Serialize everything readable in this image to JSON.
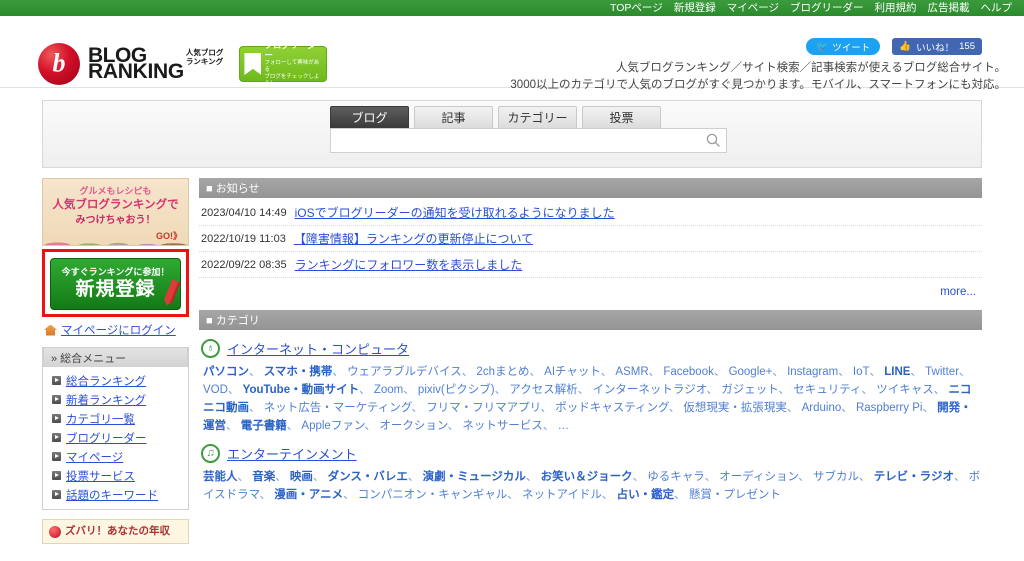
{
  "topnav": {
    "items": [
      {
        "label": "TOPページ"
      },
      {
        "label": "新規登録"
      },
      {
        "label": "マイページ"
      },
      {
        "label": "ブログリーダー"
      },
      {
        "label": "利用規約"
      },
      {
        "label": "広告掲載"
      },
      {
        "label": "ヘルプ"
      }
    ]
  },
  "header": {
    "logo_main_line1": "BLOG",
    "logo_main_line2": "RANKING",
    "logo_sub_line1": "人気ブログ",
    "logo_sub_line2": "ランキング",
    "reader_badge_title": "ブログリーダー",
    "reader_badge_line1": "フォローして興味がある",
    "reader_badge_line2": "ブログをチェックしよう！",
    "tweet_label": "ツイート",
    "like_label": "いいね！",
    "like_count": "155",
    "tagline_line1": "人気ブログランキング／サイト検索／記事検索が使えるブログ総合サイト。",
    "tagline_line2": "3000以上のカテゴリで人気のブログがすぐ見つかります。モバイル、スマートフォンにも対応。"
  },
  "search": {
    "tabs": [
      {
        "label": "ブログ",
        "active": true
      },
      {
        "label": "記事",
        "active": false
      },
      {
        "label": "カテゴリー",
        "active": false
      },
      {
        "label": "投票",
        "active": false
      }
    ],
    "input_value": "",
    "placeholder": "",
    "icon": "search-icon"
  },
  "sidebar": {
    "banner": {
      "line1": "グルメもレシピも",
      "line2": "人気ブログランキングで",
      "line3": "みつけちゃおう！",
      "cta": "GO!》"
    },
    "register": {
      "sub_label": "今すぐランキングに参加！",
      "main_label": "新規登録",
      "highlight_color": "#ee1111"
    },
    "login_label": "マイページにログイン",
    "menu_title": "» 総合メニュー",
    "menu_items": [
      {
        "label": "総合ランキング"
      },
      {
        "label": "新着ランキング"
      },
      {
        "label": "カテゴリ一覧"
      },
      {
        "label": "ブログリーダー"
      },
      {
        "label": "マイページ"
      },
      {
        "label": "投票サービス"
      },
      {
        "label": "話題のキーワード"
      }
    ],
    "promo": {
      "line1": "ズバリ！あなたの年収"
    }
  },
  "news": {
    "section_title": "■ お知らせ",
    "items": [
      {
        "date": "2023/04/10 14:49",
        "title": "iOSでブログリーダーの通知を受け取れるようになりました"
      },
      {
        "date": "2022/10/19 11:03",
        "title": "【障害情報】ランキングの更新停止について"
      },
      {
        "date": "2022/09/22 08:35",
        "title": "ランキングにフォロワー数を表示しました"
      }
    ],
    "more_label": "more..."
  },
  "categories": {
    "section_title": "■ カテゴリ",
    "blocks": [
      {
        "icon": "globe-icon",
        "icon_glyph": "♁",
        "title": "インターネット・コンピュータ",
        "links": [
          {
            "label": "パソコン",
            "bold": true
          },
          {
            "label": "スマホ・携帯",
            "bold": true
          },
          {
            "label": "ウェアラブルデバイス",
            "bold": false
          },
          {
            "label": "2chまとめ",
            "bold": false
          },
          {
            "label": "AIチャット",
            "bold": false
          },
          {
            "label": "ASMR",
            "bold": false
          },
          {
            "label": "Facebook",
            "bold": false
          },
          {
            "label": "Google+",
            "bold": false
          },
          {
            "label": "Instagram",
            "bold": false
          },
          {
            "label": "IoT",
            "bold": false
          },
          {
            "label": "LINE",
            "bold": true
          },
          {
            "label": "Twitter",
            "bold": false
          },
          {
            "label": "VOD",
            "bold": false
          },
          {
            "label": "YouTube・動画サイト",
            "bold": true
          },
          {
            "label": "Zoom",
            "bold": false
          },
          {
            "label": "pixiv(ピクシブ)",
            "bold": false
          },
          {
            "label": "アクセス解析",
            "bold": false
          },
          {
            "label": "インターネットラジオ",
            "bold": false
          },
          {
            "label": "ガジェット",
            "bold": false
          },
          {
            "label": "セキュリティ",
            "bold": false
          },
          {
            "label": "ツイキャス",
            "bold": false
          },
          {
            "label": "ニコニコ動画",
            "bold": true
          },
          {
            "label": "ネット広告・マーケティング",
            "bold": false
          },
          {
            "label": "フリマ・フリマアプリ",
            "bold": false
          },
          {
            "label": "ポッドキャスティング",
            "bold": false
          },
          {
            "label": "仮想現実・拡張現実",
            "bold": false
          },
          {
            "label": "Arduino",
            "bold": false
          },
          {
            "label": "Raspberry Pi",
            "bold": false
          },
          {
            "label": "開発・運営",
            "bold": true
          },
          {
            "label": "電子書籍",
            "bold": true
          },
          {
            "label": "Appleファン",
            "bold": false
          },
          {
            "label": "オークション",
            "bold": false
          },
          {
            "label": "ネットサービス",
            "bold": false
          },
          {
            "label": "…",
            "bold": false
          }
        ]
      },
      {
        "icon": "music-note-icon",
        "icon_glyph": "♫",
        "title": "エンターテインメント",
        "links": [
          {
            "label": "芸能人",
            "bold": true
          },
          {
            "label": "音楽",
            "bold": true
          },
          {
            "label": "映画",
            "bold": true
          },
          {
            "label": "ダンス・バレエ",
            "bold": true
          },
          {
            "label": "演劇・ミュージカル",
            "bold": true
          },
          {
            "label": "お笑い＆ジョーク",
            "bold": true
          },
          {
            "label": "ゆるキャラ",
            "bold": false
          },
          {
            "label": "オーディション",
            "bold": false
          },
          {
            "label": "サブカル",
            "bold": false
          },
          {
            "label": "テレビ・ラジオ",
            "bold": true
          },
          {
            "label": "ボイスドラマ",
            "bold": false
          },
          {
            "label": "漫画・アニメ",
            "bold": true
          },
          {
            "label": "コンパニオン・キャンギャル",
            "bold": false
          },
          {
            "label": "ネットアイドル",
            "bold": false
          },
          {
            "label": "占い・鑑定",
            "bold": true
          },
          {
            "label": "懸賞・プレゼント",
            "bold": false
          }
        ]
      }
    ]
  }
}
